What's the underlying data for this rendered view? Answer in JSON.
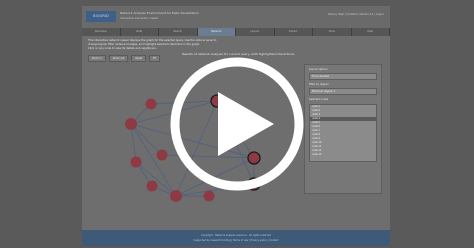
{
  "header": {
    "logo_text": "BIOGRID",
    "app_title": "Network Analysis Environment for Data Visualization",
    "app_subtitle": "Interactive interaction viewer",
    "links": "Home | Help | Contact | Version 4.1 | Log in"
  },
  "tabs": [
    {
      "label": "Overview",
      "active": false
    },
    {
      "label": "Data",
      "active": false
    },
    {
      "label": "Search",
      "active": false
    },
    {
      "label": "Network",
      "active": true
    },
    {
      "label": "Layout",
      "active": false
    },
    {
      "label": "Export",
      "active": false
    },
    {
      "label": "Tools",
      "active": false
    },
    {
      "label": "Help",
      "active": false
    }
  ],
  "intro": {
    "line1": "This interactive network viewer displays the graph for the selected query. Use the options panel to",
    "line2": "change layout, filter nodes and edges, and highlight selected interactors in the graph.",
    "line3": "Click on any node to view its details and neighbours."
  },
  "buttons": {
    "zoom_in": "Zoom in",
    "zoom_out": "Zoom out",
    "reset": "Reset",
    "fit": "Fit"
  },
  "graph": {
    "title": "Results of network analysis for current query, with highlighted interactions"
  },
  "side_panel": {
    "layout_label": "Layout options",
    "layout_select": "Force directed",
    "filter_label": "Filter by degree",
    "filter_select": "Minimum degree: 1",
    "nodes_label": "Selected nodes",
    "nodes": [
      {
        "label": "node 1",
        "selected": false
      },
      {
        "label": "node 2",
        "selected": false
      },
      {
        "label": "node 3",
        "selected": false
      },
      {
        "label": "node 4",
        "selected": true
      },
      {
        "label": "node 5",
        "selected": false
      },
      {
        "label": "node 6",
        "selected": false
      },
      {
        "label": "node 7",
        "selected": false
      },
      {
        "label": "node 8",
        "selected": false
      },
      {
        "label": "node 9",
        "selected": false
      },
      {
        "label": "node 10",
        "selected": false
      },
      {
        "label": "node 11",
        "selected": false
      },
      {
        "label": "node 12",
        "selected": false
      },
      {
        "label": "node 13",
        "selected": false
      }
    ]
  },
  "footer": {
    "line1": "Copyright - Network analysis resource - All rights reserved",
    "line2": "Supported by research funding | Terms of use | Privacy policy | Contact"
  },
  "colors": {
    "node_fill": "#8e3a45",
    "highlight_ring": "#1a1a1a",
    "edge": "#4a5f86",
    "overlay_play": "#ffffff"
  },
  "overlay": {
    "icon": "play-icon"
  }
}
